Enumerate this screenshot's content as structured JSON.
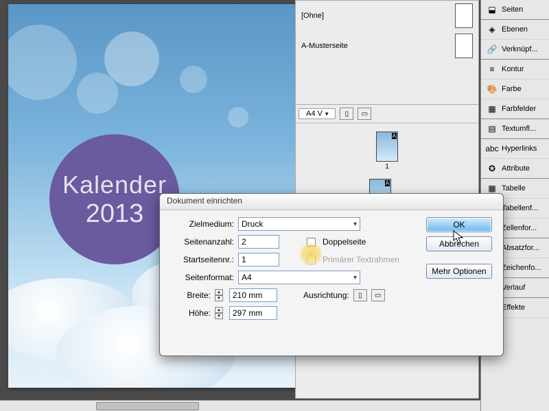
{
  "document": {
    "title_line1": "Kalender",
    "title_line2": "2013"
  },
  "pages_panel": {
    "masters": {
      "none": "[Ohne]",
      "master_a": "A-Musterseite"
    },
    "size_dropdown": "A4 V",
    "page_label_1": "1"
  },
  "right_panels": [
    {
      "icon": "⬓",
      "label": "Seiten"
    },
    {
      "icon": "◈",
      "label": "Ebenen"
    },
    {
      "icon": "🔗",
      "label": "Verknüpf..."
    },
    {
      "icon": "≡",
      "label": "Kontur"
    },
    {
      "icon": "🎨",
      "label": "Farbe"
    },
    {
      "icon": "▦",
      "label": "Farbfelder"
    },
    {
      "icon": "▤",
      "label": "Textumfl..."
    },
    {
      "icon": "abc",
      "label": "Hyperlinks"
    },
    {
      "icon": "✪",
      "label": "Attribute"
    },
    {
      "icon": "▦",
      "label": "Tabelle"
    },
    {
      "icon": "▥",
      "label": "Tabellenf..."
    },
    {
      "icon": "▤",
      "label": "Zellenfor..."
    },
    {
      "icon": "¶",
      "label": "Absatzfor..."
    },
    {
      "icon": "A",
      "label": "Zeichenfo..."
    },
    {
      "icon": "▬",
      "label": "Verlauf"
    },
    {
      "icon": "fx",
      "label": "Effekte"
    }
  ],
  "dialog": {
    "title": "Dokument einrichten",
    "labels": {
      "zielmedium": "Zielmedium:",
      "seitenanzahl": "Seitenanzahl:",
      "startseitennr": "Startseitennr.:",
      "seitenformat": "Seitenformat:",
      "breite": "Breite:",
      "hoehe": "Höhe:",
      "ausrichtung": "Ausrichtung:",
      "doppelseite": "Doppelseite",
      "primaer": "Primärer Textrahmen"
    },
    "values": {
      "zielmedium": "Druck",
      "seitenanzahl": "2",
      "startseitennr": "1",
      "seitenformat": "A4",
      "breite": "210 mm",
      "hoehe": "297 mm"
    },
    "buttons": {
      "ok": "OK",
      "abbrechen": "Abbrechen",
      "mehr": "Mehr Optionen"
    }
  }
}
